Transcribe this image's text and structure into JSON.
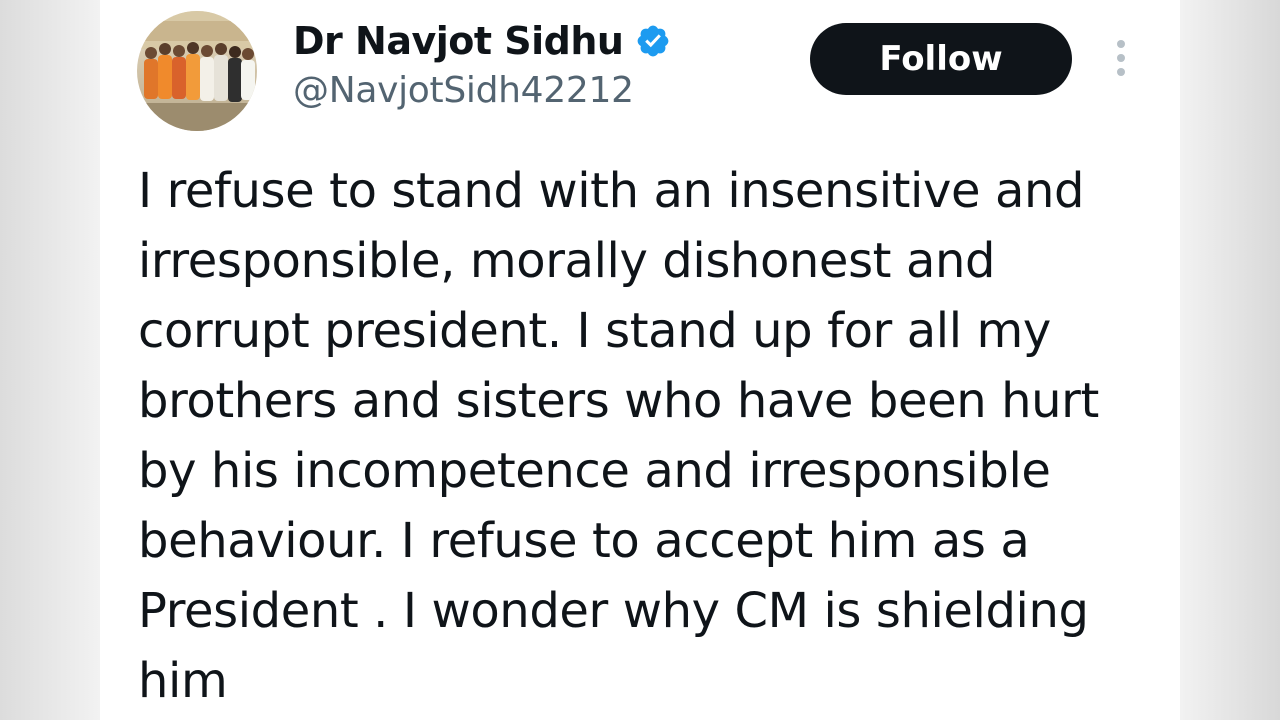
{
  "author": {
    "display_name": "Dr Navjot Sidhu",
    "handle": "@NavjotSidh42212",
    "verified": true
  },
  "actions": {
    "follow_label": "Follow"
  },
  "icons": {
    "verified": "verified-badge-icon",
    "more": "more-vertical-icon",
    "avatar": "profile-photo"
  },
  "colors": {
    "text": "#0f1419",
    "secondary_text": "#536471",
    "verified_blue": "#1d9bf0",
    "follow_bg": "#0f1419"
  },
  "tweet": {
    "lines": [
      "I refuse to stand with an insensitive and",
      "irresponsible, morally dishonest and",
      "corrupt president. I stand up for all my",
      "brothers and sisters who have been hurt",
      "by his incompetence and irresponsible",
      "behaviour. I refuse to accept him as a",
      "President . I wonder why CM is shielding",
      "him"
    ]
  }
}
